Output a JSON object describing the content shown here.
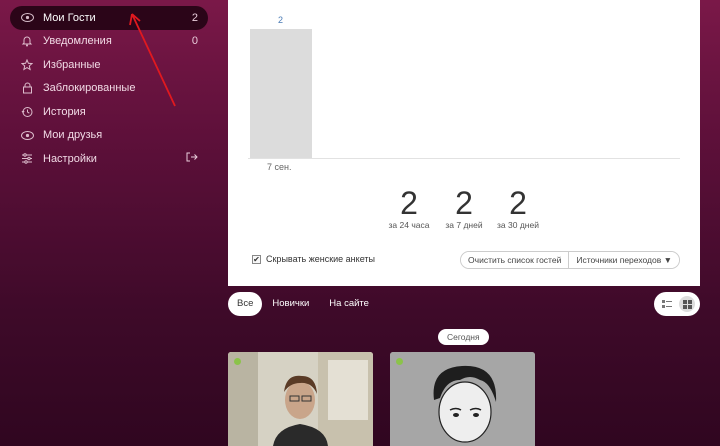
{
  "sidebar": {
    "items": [
      {
        "label": "Мои Гости",
        "count": "2",
        "icon": "eye-icon"
      },
      {
        "label": "Уведомления",
        "count": "0",
        "icon": "bell-icon"
      },
      {
        "label": "Избранные",
        "icon": "star-icon"
      },
      {
        "label": "Заблокированные",
        "icon": "lock-icon"
      },
      {
        "label": "История",
        "icon": "history-icon"
      },
      {
        "label": "Мои друзья",
        "icon": "eye-icon"
      },
      {
        "label": "Настройки",
        "icon": "sliders-icon",
        "trailing_icon": "logout-icon"
      }
    ]
  },
  "chart_data": {
    "type": "bar",
    "categories": [
      "7 сен."
    ],
    "values": [
      2
    ],
    "data_labels": [
      "2"
    ],
    "ylim": [
      0,
      2
    ]
  },
  "stats": [
    {
      "value": "2",
      "caption": "за 24 часа"
    },
    {
      "value": "2",
      "caption": "за 7 дней"
    },
    {
      "value": "2",
      "caption": "за 30 дней"
    }
  ],
  "options": {
    "hide_female_label": "Скрывать женские анкеты",
    "hide_female_checked": true,
    "clear_button": "Очистить список гостей",
    "sources_button": "Источники переходов ▼"
  },
  "tabs": [
    {
      "label": "Все",
      "active": true
    },
    {
      "label": "Новички",
      "active": false
    },
    {
      "label": "На сайте",
      "active": false
    }
  ],
  "view_toggle": {
    "options": [
      "list-view-icon",
      "grid-view-icon"
    ],
    "active": "grid-view-icon"
  },
  "day_badge": "Сегодня",
  "guests": [
    {
      "online": true
    },
    {
      "online": true
    }
  ],
  "colors": {
    "accent_bg": "#5a0f38",
    "active_item_bg": "#2b0518",
    "bar": "#dcdcdc",
    "online": "#8bc34a",
    "annotation": "#e0191f"
  }
}
